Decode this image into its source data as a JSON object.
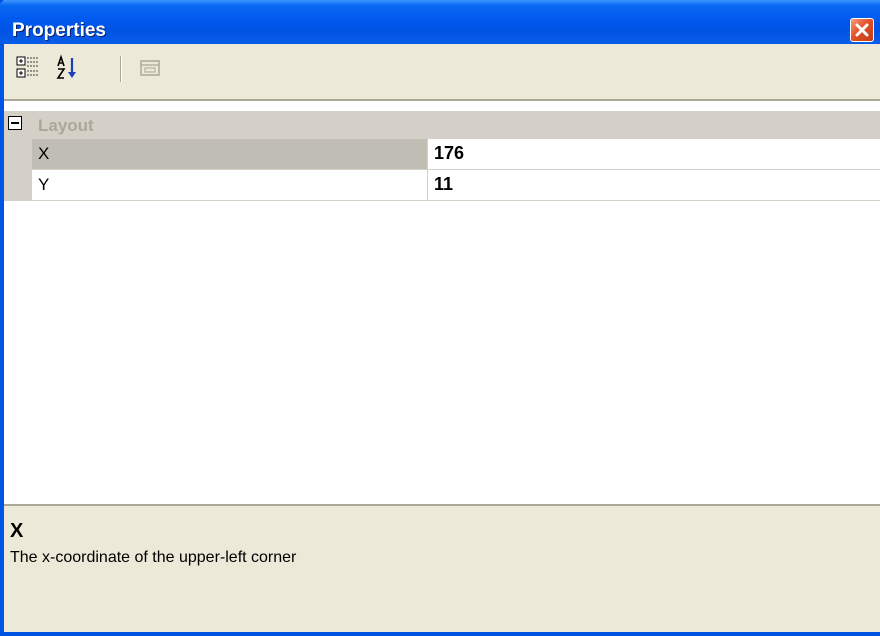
{
  "window": {
    "title": "Properties"
  },
  "toolbar": {
    "buttons": [
      {
        "name": "categorized-view",
        "icon": "categorized-icon"
      },
      {
        "name": "alphabetical-view",
        "icon": "sort-az-icon"
      },
      {
        "name": "property-pages",
        "icon": "property-pages-icon"
      }
    ]
  },
  "grid": {
    "category": {
      "label": "Layout",
      "expanded": true
    },
    "properties": [
      {
        "name": "X",
        "value": "176",
        "selected": true
      },
      {
        "name": "Y",
        "value": "11",
        "selected": false
      }
    ]
  },
  "description": {
    "title": "X",
    "text": "The x-coordinate of the upper-left corner"
  },
  "colors": {
    "titlebar": "#0054e3",
    "panel": "#ece9d8",
    "margin": "#d4d0c8",
    "category_text": "#aca899"
  }
}
